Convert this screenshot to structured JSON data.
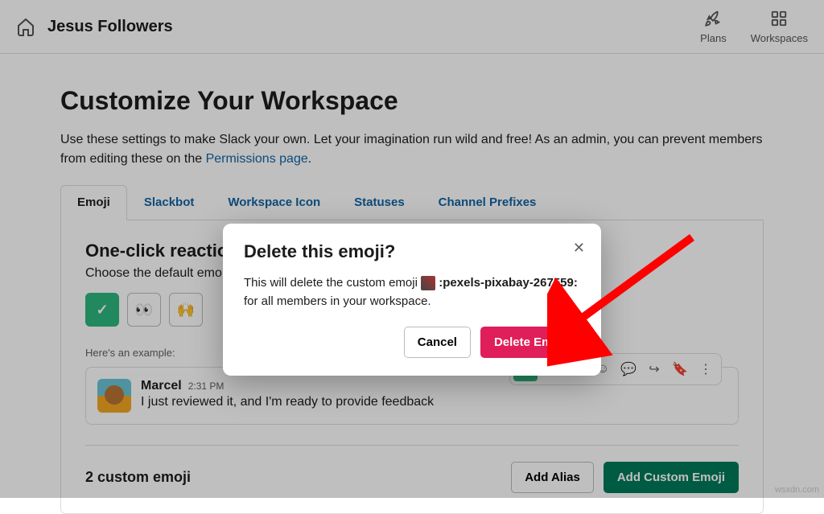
{
  "header": {
    "workspace_name": "Jesus Followers",
    "plans_label": "Plans",
    "workspaces_label": "Workspaces"
  },
  "page": {
    "title": "Customize Your Workspace",
    "desc_pre": "Use these settings to make Slack your own. Let your imagination run wild and free! As an admin, you can prevent members from editing these on the ",
    "desc_link": "Permissions page",
    "desc_post": "."
  },
  "tabs": {
    "emoji": "Emoji",
    "slackbot": "Slackbot",
    "workspace_icon": "Workspace Icon",
    "statuses": "Statuses",
    "channel_prefixes": "Channel Prefixes"
  },
  "reactions": {
    "title": "One-click reactions",
    "desc": "Choose the default emo",
    "example_label": "Here's an example:"
  },
  "message": {
    "name": "Marcel",
    "time": "2:31 PM",
    "text": "I just reviewed it, and I'm ready to provide feedback"
  },
  "custom": {
    "count_text": "2 custom emoji",
    "add_alias": "Add Alias",
    "add_custom": "Add Custom Emoji"
  },
  "modal": {
    "title": "Delete this emoji?",
    "body_pre": "This will delete the custom emoji ",
    "emoji_name": ":pexels-pixabay-267559:",
    "body_post": " for all members in your workspace.",
    "cancel": "Cancel",
    "delete": "Delete Emoji"
  },
  "watermark": "wsxdn.com"
}
